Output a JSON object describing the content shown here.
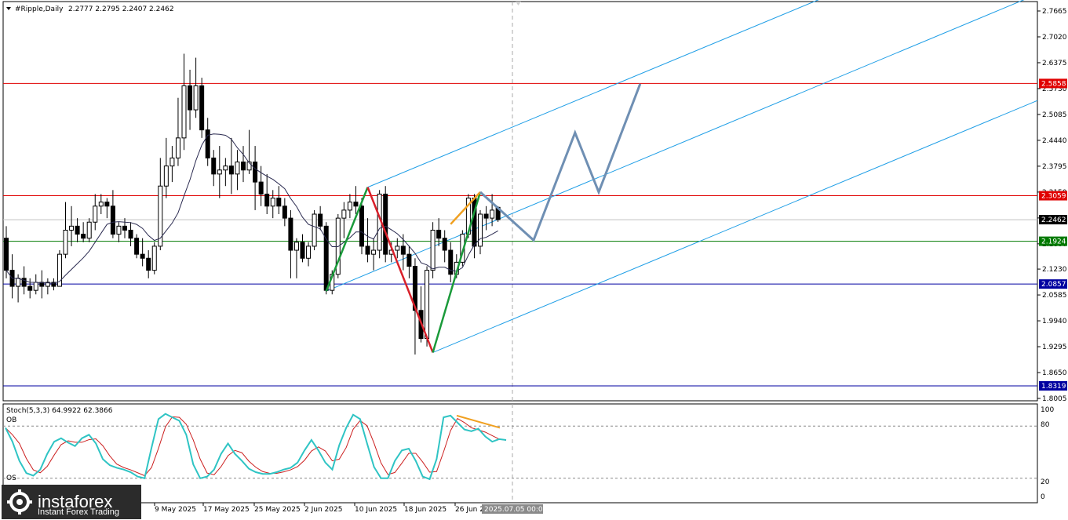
{
  "header": {
    "symbol_label": "#Ripple,Daily",
    "ohlc": "2.2777 2.2795 2.2407 2.2462"
  },
  "price_axis": {
    "ticks": [
      "2.7665",
      "2.7020",
      "2.6375",
      "2.5730",
      "2.5085",
      "2.4440",
      "2.3795",
      "2.3150",
      "2.2505",
      "2.1860",
      "2.1230",
      "2.0585",
      "1.9940",
      "1.9295",
      "1.8650",
      "1.8005"
    ],
    "current_price": "2.2462"
  },
  "levels": [
    {
      "label": "2.5858",
      "value": 2.5858,
      "color": "#e00000"
    },
    {
      "label": "2.3059",
      "value": 2.3059,
      "color": "#e00000"
    },
    {
      "label": "2.1924",
      "value": 2.1924,
      "color": "#007a00"
    },
    {
      "label": "2.0857",
      "value": 2.0857,
      "color": "#0000a0"
    },
    {
      "label": "1.8319",
      "value": 1.8319,
      "color": "#0000a0"
    }
  ],
  "date_axis": {
    "labels": [
      "9 May 2025",
      "17 May 2025",
      "25 May 2025",
      "2 Jun 2025",
      "10 Jun 2025",
      "18 Jun 2025",
      "26 Jun 2025"
    ],
    "cursor_label": "2025.07.05 00:00"
  },
  "stochastic": {
    "label": "Stoch(5,3,3) 64.9922 62.3866",
    "ob_label": "OB",
    "os_label": "OS",
    "scale": [
      "100",
      "80",
      "20",
      "0"
    ]
  },
  "logo": {
    "name": "instaforex",
    "tagline": "Instant Forex Trading"
  },
  "colors": {
    "channel": "#1e9ee6",
    "projection": "#6f8fb3",
    "bull_leg": "#1a9a3a",
    "bear_leg": "#d8202a",
    "divergence": "#f0a020",
    "stoch_main": "#2fc4c4",
    "stoch_signal": "#cc2020",
    "ma": "#2a2a50"
  },
  "chart_data": {
    "type": "candlestick",
    "symbol": "#Ripple",
    "timeframe": "Daily",
    "ylim": [
      1.8005,
      2.7665
    ],
    "candles": [
      [
        2.2,
        2.23,
        2.1,
        2.12
      ],
      [
        2.12,
        2.16,
        2.05,
        2.08
      ],
      [
        2.08,
        2.11,
        2.04,
        2.1
      ],
      [
        2.1,
        2.13,
        2.06,
        2.08
      ],
      [
        2.08,
        2.1,
        2.05,
        2.07
      ],
      [
        2.07,
        2.11,
        2.06,
        2.09
      ],
      [
        2.09,
        2.12,
        2.05,
        2.08
      ],
      [
        2.08,
        2.1,
        2.06,
        2.09
      ],
      [
        2.09,
        2.1,
        2.07,
        2.08
      ],
      [
        2.08,
        2.17,
        2.08,
        2.16
      ],
      [
        2.16,
        2.29,
        2.15,
        2.22
      ],
      [
        2.22,
        2.28,
        2.18,
        2.23
      ],
      [
        2.23,
        2.25,
        2.19,
        2.21
      ],
      [
        2.21,
        2.24,
        2.19,
        2.2
      ],
      [
        2.2,
        2.25,
        2.19,
        2.24
      ],
      [
        2.24,
        2.31,
        2.22,
        2.28
      ],
      [
        2.28,
        2.31,
        2.26,
        2.29
      ],
      [
        2.29,
        2.3,
        2.25,
        2.28
      ],
      [
        2.28,
        2.32,
        2.2,
        2.21
      ],
      [
        2.21,
        2.24,
        2.19,
        2.23
      ],
      [
        2.23,
        2.25,
        2.2,
        2.22
      ],
      [
        2.22,
        2.24,
        2.18,
        2.2
      ],
      [
        2.2,
        2.21,
        2.15,
        2.16
      ],
      [
        2.16,
        2.2,
        2.13,
        2.15
      ],
      [
        2.15,
        2.17,
        2.1,
        2.12
      ],
      [
        2.12,
        2.19,
        2.11,
        2.18
      ],
      [
        2.18,
        2.4,
        2.17,
        2.33
      ],
      [
        2.33,
        2.45,
        2.3,
        2.38
      ],
      [
        2.38,
        2.43,
        2.34,
        2.4
      ],
      [
        2.4,
        2.55,
        2.38,
        2.45
      ],
      [
        2.45,
        2.66,
        2.42,
        2.58
      ],
      [
        2.58,
        2.62,
        2.47,
        2.52
      ],
      [
        2.52,
        2.65,
        2.5,
        2.58
      ],
      [
        2.58,
        2.6,
        2.45,
        2.47
      ],
      [
        2.47,
        2.5,
        2.38,
        2.4
      ],
      [
        2.4,
        2.42,
        2.33,
        2.36
      ],
      [
        2.36,
        2.43,
        2.3,
        2.37
      ],
      [
        2.37,
        2.4,
        2.33,
        2.38
      ],
      [
        2.38,
        2.45,
        2.31,
        2.36
      ],
      [
        2.36,
        2.42,
        2.32,
        2.39
      ],
      [
        2.39,
        2.43,
        2.34,
        2.37
      ],
      [
        2.37,
        2.47,
        2.36,
        2.39
      ],
      [
        2.39,
        2.43,
        2.27,
        2.34
      ],
      [
        2.34,
        2.38,
        2.28,
        2.31
      ],
      [
        2.31,
        2.36,
        2.26,
        2.28
      ],
      [
        2.28,
        2.32,
        2.25,
        2.3
      ],
      [
        2.3,
        2.33,
        2.26,
        2.28
      ],
      [
        2.28,
        2.3,
        2.23,
        2.25
      ],
      [
        2.25,
        2.27,
        2.1,
        2.17
      ],
      [
        2.17,
        2.2,
        2.1,
        2.19
      ],
      [
        2.19,
        2.21,
        2.14,
        2.15
      ],
      [
        2.15,
        2.19,
        2.13,
        2.18
      ],
      [
        2.18,
        2.27,
        2.17,
        2.26
      ],
      [
        2.26,
        2.28,
        2.22,
        2.23
      ],
      [
        2.23,
        2.24,
        2.06,
        2.07
      ],
      [
        2.07,
        2.12,
        2.06,
        2.11
      ],
      [
        2.11,
        2.26,
        2.1,
        2.25
      ],
      [
        2.25,
        2.29,
        2.2,
        2.27
      ],
      [
        2.27,
        2.31,
        2.25,
        2.29
      ],
      [
        2.29,
        2.33,
        2.26,
        2.28
      ],
      [
        2.28,
        2.3,
        2.16,
        2.18
      ],
      [
        2.18,
        2.25,
        2.14,
        2.16
      ],
      [
        2.16,
        2.2,
        2.12,
        2.17
      ],
      [
        2.17,
        2.32,
        2.15,
        2.31
      ],
      [
        2.31,
        2.33,
        2.14,
        2.16
      ],
      [
        2.16,
        2.19,
        2.14,
        2.17
      ],
      [
        2.17,
        2.2,
        2.15,
        2.18
      ],
      [
        2.18,
        2.21,
        2.12,
        2.16
      ],
      [
        2.16,
        2.18,
        2.1,
        2.13
      ],
      [
        2.13,
        2.15,
        1.91,
        2.02
      ],
      [
        2.02,
        2.08,
        1.94,
        1.95
      ],
      [
        1.95,
        2.13,
        1.93,
        2.12
      ],
      [
        2.12,
        2.24,
        2.1,
        2.22
      ],
      [
        2.22,
        2.25,
        2.18,
        2.2
      ],
      [
        2.2,
        2.22,
        2.14,
        2.17
      ],
      [
        2.17,
        2.19,
        2.09,
        2.11
      ],
      [
        2.11,
        2.16,
        2.1,
        2.14
      ],
      [
        2.14,
        2.22,
        2.13,
        2.21
      ],
      [
        2.21,
        2.31,
        2.2,
        2.3
      ],
      [
        2.3,
        2.31,
        2.15,
        2.18
      ],
      [
        2.18,
        2.27,
        2.16,
        2.26
      ],
      [
        2.26,
        2.28,
        2.22,
        2.25
      ],
      [
        2.25,
        2.31,
        2.23,
        2.27
      ],
      [
        2.277,
        2.2795,
        2.2407,
        2.2462
      ]
    ],
    "horizontal_levels": [
      2.5858,
      2.3059,
      2.1924,
      2.0857,
      1.8319
    ],
    "stochastic": {
      "main": 64.9922,
      "signal": 62.3866,
      "ob": 80,
      "os": 20,
      "ylim": [
        0,
        100
      ]
    }
  }
}
